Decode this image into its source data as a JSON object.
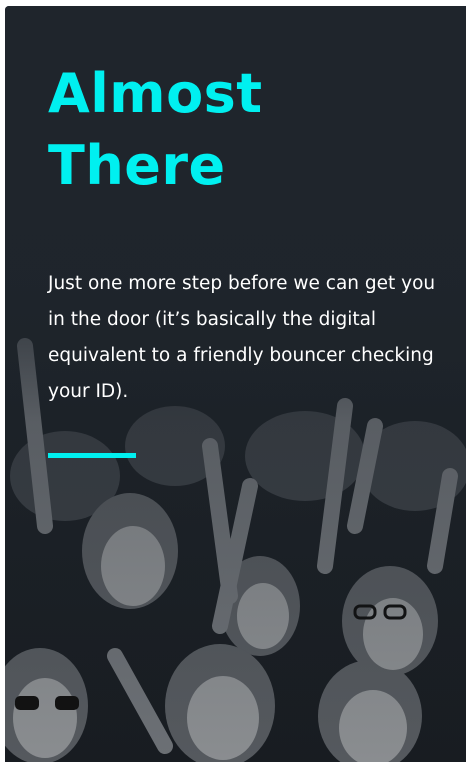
{
  "hero": {
    "headline_line1": "Almost",
    "headline_line2": "There",
    "body": "Just one more step before we can get you in the door (it’s basically the digital equivalent to a friendly bouncer checking your ID)."
  },
  "colors": {
    "accent": "#00f0f0",
    "panel_background": "#1f252c",
    "text": "#ffffff"
  },
  "background_image": {
    "icon": "concert-crowd-photo"
  }
}
